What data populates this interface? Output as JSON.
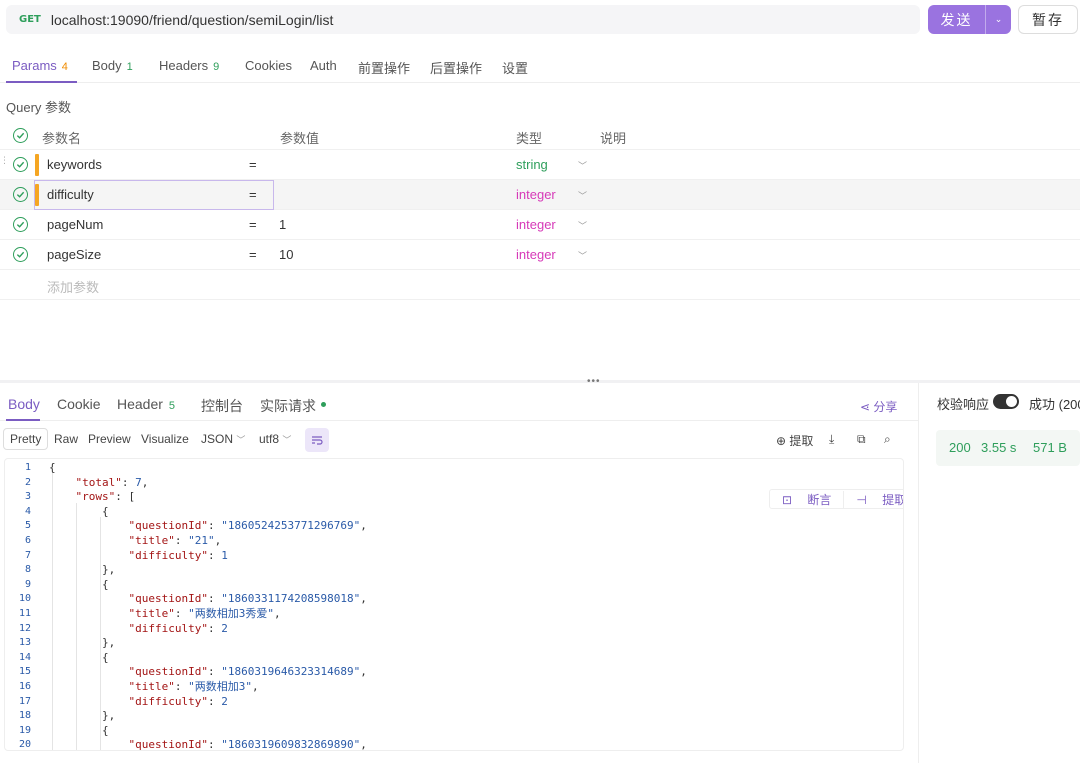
{
  "request": {
    "method": "GET",
    "url": "localhost:19090/friend/question/semiLogin/list",
    "send_label": "发送",
    "save_label": "暂存"
  },
  "req_tabs": [
    {
      "label": "Params",
      "count": "4"
    },
    {
      "label": "Body",
      "count": "1"
    },
    {
      "label": "Headers",
      "count": "9"
    },
    {
      "label": "Cookies",
      "count": ""
    },
    {
      "label": "Auth",
      "count": ""
    },
    {
      "label": "前置操作",
      "count": ""
    },
    {
      "label": "后置操作",
      "count": ""
    },
    {
      "label": "设置",
      "count": ""
    }
  ],
  "query": {
    "section_label": "Query 参数",
    "headers": {
      "name": "参数名",
      "value": "参数值",
      "type": "类型",
      "desc": "说明"
    },
    "rows": [
      {
        "name": "keywords",
        "eq": "=",
        "value": "",
        "type": "string"
      },
      {
        "name": "difficulty",
        "eq": "=",
        "value": "",
        "type": "integer"
      },
      {
        "name": "pageNum",
        "eq": "=",
        "value": "1",
        "type": "integer"
      },
      {
        "name": "pageSize",
        "eq": "=",
        "value": "10",
        "type": "integer"
      }
    ],
    "add_placeholder": "添加参数"
  },
  "resp_tabs": [
    {
      "label": "Body",
      "count": ""
    },
    {
      "label": "Cookie",
      "count": ""
    },
    {
      "label": "Header",
      "count": "5"
    },
    {
      "label": "控制台",
      "count": ""
    },
    {
      "label": "实际请求",
      "count": ""
    }
  ],
  "share_label": "分享",
  "formats": {
    "views": [
      "Pretty",
      "Raw",
      "Preview",
      "Visualize"
    ],
    "language": "JSON",
    "encoding": "utf8",
    "extract_label": "提取"
  },
  "code_tools": {
    "assert_label": "断言",
    "extract_var_label": "提取变量"
  },
  "code_lines": [
    {
      "n": "1",
      "parts": [
        [
          "p",
          "{"
        ]
      ]
    },
    {
      "n": "2",
      "parts": [
        [
          "p",
          "    "
        ],
        [
          "k",
          "\"total\""
        ],
        [
          "p",
          ": "
        ],
        [
          "n",
          "7"
        ],
        [
          "p",
          ","
        ]
      ]
    },
    {
      "n": "3",
      "parts": [
        [
          "p",
          "    "
        ],
        [
          "k",
          "\"rows\""
        ],
        [
          "p",
          ": ["
        ]
      ]
    },
    {
      "n": "4",
      "parts": [
        [
          "p",
          "        {"
        ]
      ]
    },
    {
      "n": "5",
      "parts": [
        [
          "p",
          "            "
        ],
        [
          "k",
          "\"questionId\""
        ],
        [
          "p",
          ": "
        ],
        [
          "s",
          "\"1860524253771296769\""
        ],
        [
          "p",
          ","
        ]
      ]
    },
    {
      "n": "6",
      "parts": [
        [
          "p",
          "            "
        ],
        [
          "k",
          "\"title\""
        ],
        [
          "p",
          ": "
        ],
        [
          "s",
          "\"21\""
        ],
        [
          "p",
          ","
        ]
      ]
    },
    {
      "n": "7",
      "parts": [
        [
          "p",
          "            "
        ],
        [
          "k",
          "\"difficulty\""
        ],
        [
          "p",
          ": "
        ],
        [
          "n",
          "1"
        ]
      ]
    },
    {
      "n": "8",
      "parts": [
        [
          "p",
          "        },"
        ]
      ]
    },
    {
      "n": "9",
      "parts": [
        [
          "p",
          "        {"
        ]
      ]
    },
    {
      "n": "10",
      "parts": [
        [
          "p",
          "            "
        ],
        [
          "k",
          "\"questionId\""
        ],
        [
          "p",
          ": "
        ],
        [
          "s",
          "\"1860331174208598018\""
        ],
        [
          "p",
          ","
        ]
      ]
    },
    {
      "n": "11",
      "parts": [
        [
          "p",
          "            "
        ],
        [
          "k",
          "\"title\""
        ],
        [
          "p",
          ": "
        ],
        [
          "s",
          "\"两数相加3秀爱\""
        ],
        [
          "p",
          ","
        ]
      ]
    },
    {
      "n": "12",
      "parts": [
        [
          "p",
          "            "
        ],
        [
          "k",
          "\"difficulty\""
        ],
        [
          "p",
          ": "
        ],
        [
          "n",
          "2"
        ]
      ]
    },
    {
      "n": "13",
      "parts": [
        [
          "p",
          "        },"
        ]
      ]
    },
    {
      "n": "14",
      "parts": [
        [
          "p",
          "        {"
        ]
      ]
    },
    {
      "n": "15",
      "parts": [
        [
          "p",
          "            "
        ],
        [
          "k",
          "\"questionId\""
        ],
        [
          "p",
          ": "
        ],
        [
          "s",
          "\"1860319646323314689\""
        ],
        [
          "p",
          ","
        ]
      ]
    },
    {
      "n": "16",
      "parts": [
        [
          "p",
          "            "
        ],
        [
          "k",
          "\"title\""
        ],
        [
          "p",
          ": "
        ],
        [
          "s",
          "\"两数相加3\""
        ],
        [
          "p",
          ","
        ]
      ]
    },
    {
      "n": "17",
      "parts": [
        [
          "p",
          "            "
        ],
        [
          "k",
          "\"difficulty\""
        ],
        [
          "p",
          ": "
        ],
        [
          "n",
          "2"
        ]
      ]
    },
    {
      "n": "18",
      "parts": [
        [
          "p",
          "        },"
        ]
      ]
    },
    {
      "n": "19",
      "parts": [
        [
          "p",
          "        {"
        ]
      ]
    },
    {
      "n": "20",
      "parts": [
        [
          "p",
          "            "
        ],
        [
          "k",
          "\"questionId\""
        ],
        [
          "p",
          ": "
        ],
        [
          "s",
          "\"1860319609832869890\""
        ],
        [
          "p",
          ","
        ]
      ]
    }
  ],
  "response": {
    "verify_label": "校验响应",
    "success_label": "成功 (200",
    "status": "200",
    "time": "3.55 s",
    "size": "571 B"
  },
  "colors": {
    "accent": "#7b5cc2",
    "send": "#9a73e0",
    "success": "#2e9e5b",
    "integer": "#d63ab8"
  }
}
